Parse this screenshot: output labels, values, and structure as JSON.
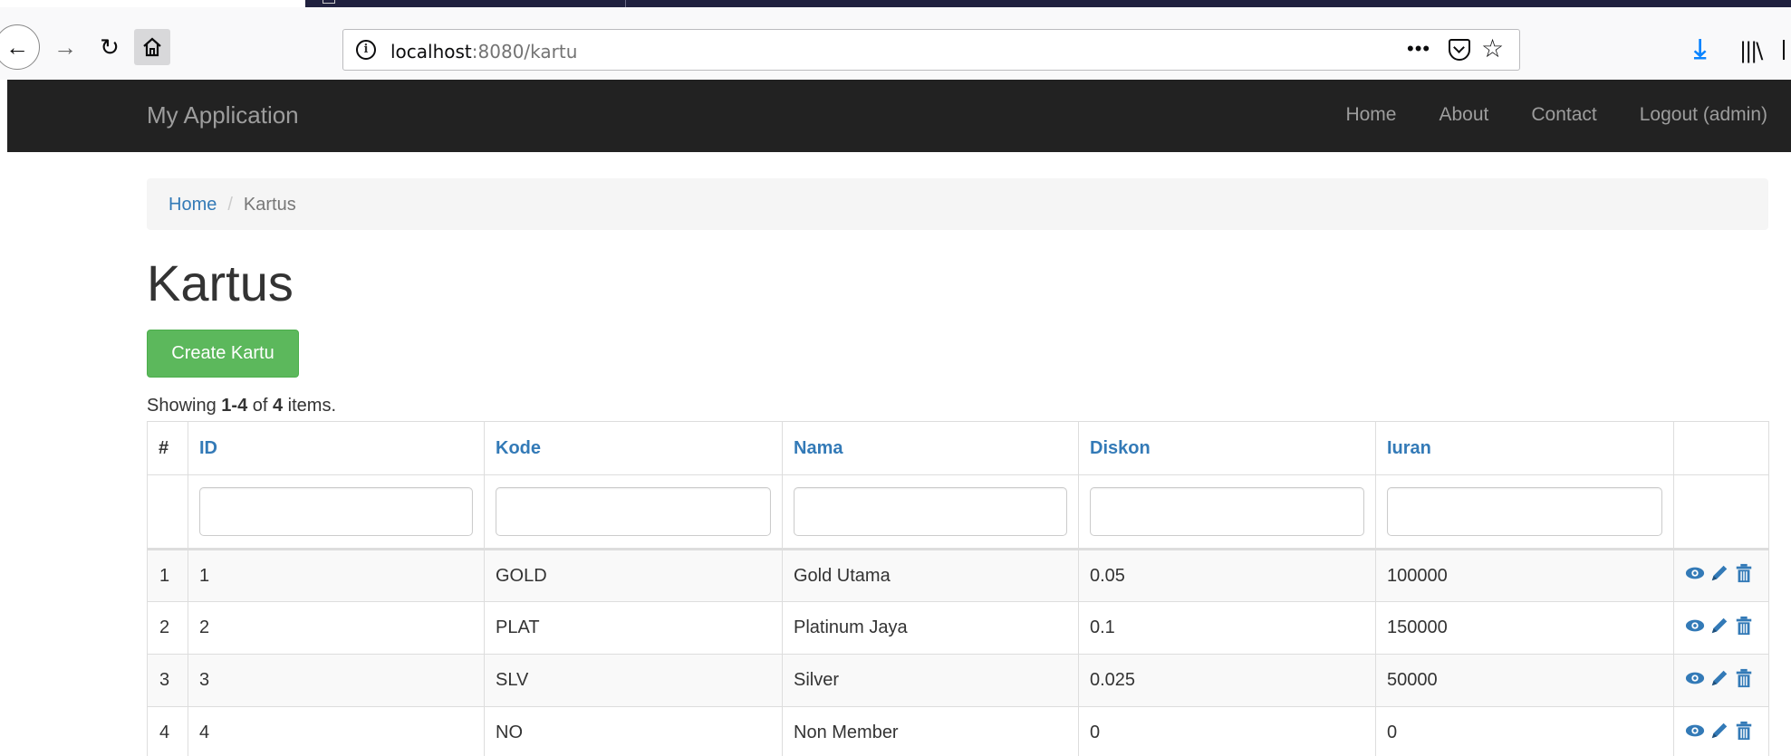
{
  "browser": {
    "url_host": "localhost",
    "url_rest": ":8080/kartu",
    "page_actions_label": "•••"
  },
  "app": {
    "brand": "My Application",
    "nav": [
      {
        "label": "Home"
      },
      {
        "label": "About"
      },
      {
        "label": "Contact"
      },
      {
        "label": "Logout (admin)"
      }
    ]
  },
  "breadcrumb": {
    "home": "Home",
    "separator": "/",
    "current": "Kartus"
  },
  "page": {
    "title": "Kartus",
    "create_button": "Create Kartu"
  },
  "summary": {
    "prefix": "Showing ",
    "range": "1-4",
    "middle": " of ",
    "total": "4",
    "suffix": " items."
  },
  "grid": {
    "columns": {
      "serial": "#",
      "id": "ID",
      "kode": "Kode",
      "nama": "Nama",
      "diskon": "Diskon",
      "iuran": "Iuran"
    },
    "rows": [
      {
        "no": "1",
        "id": "1",
        "kode": "GOLD",
        "nama": "Gold Utama",
        "diskon": "0.05",
        "iuran": "100000"
      },
      {
        "no": "2",
        "id": "2",
        "kode": "PLAT",
        "nama": "Platinum Jaya",
        "diskon": "0.1",
        "iuran": "150000"
      },
      {
        "no": "3",
        "id": "3",
        "kode": "SLV",
        "nama": "Silver",
        "diskon": "0.025",
        "iuran": "50000"
      },
      {
        "no": "4",
        "id": "4",
        "kode": "NO",
        "nama": "Non Member",
        "diskon": "0",
        "iuran": "0"
      }
    ],
    "action_icons": [
      "view-icon",
      "edit-icon",
      "delete-icon"
    ]
  },
  "colors": {
    "link": "#337ab7",
    "success": "#5cb85c",
    "navbar": "#222222",
    "download_blue": "#0a84ff"
  }
}
